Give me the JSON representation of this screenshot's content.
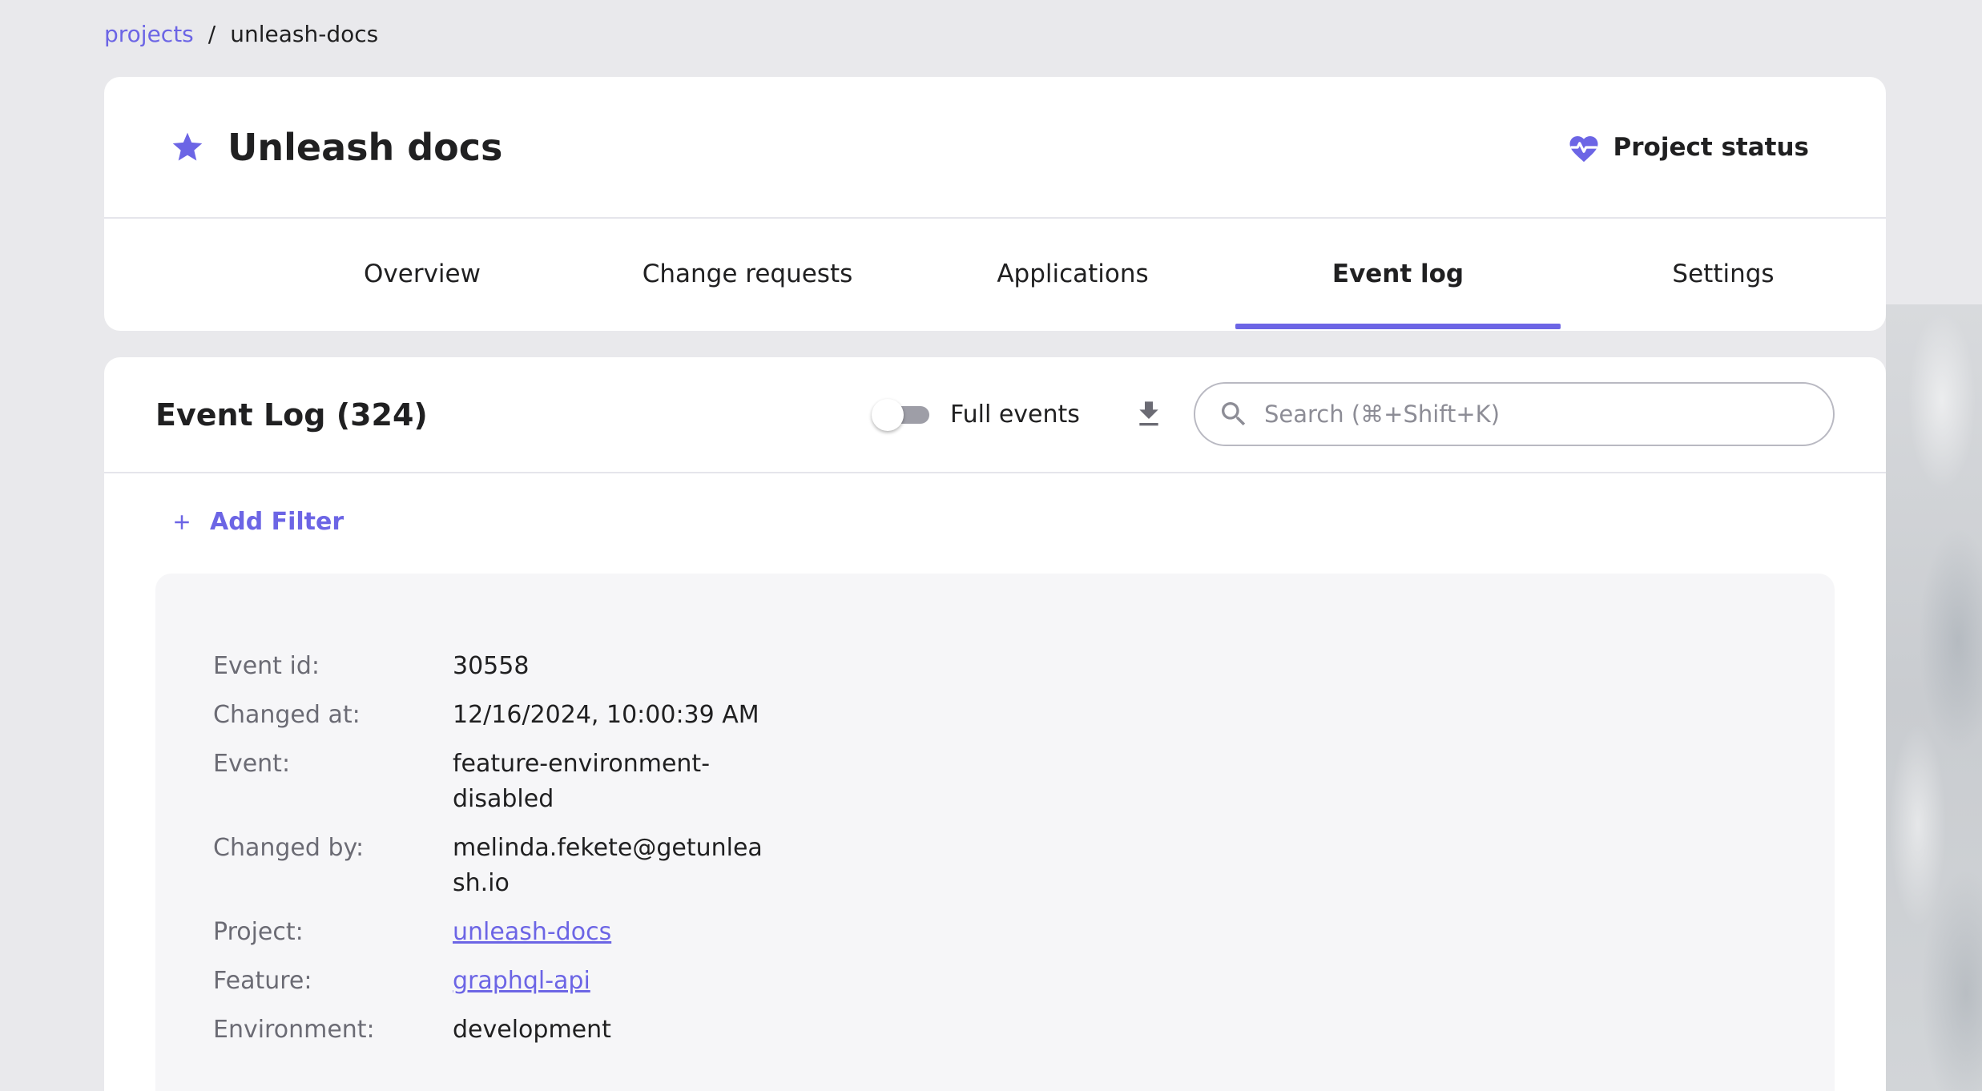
{
  "breadcrumb": {
    "link": "projects",
    "separator": "/",
    "current": "unleash-docs"
  },
  "header": {
    "title": "Unleash docs",
    "favorite_icon": "star-icon",
    "status_label": "Project status",
    "status_icon": "heart-pulse-icon"
  },
  "tabs": [
    {
      "label": "Overview",
      "active": false
    },
    {
      "label": "Change requests",
      "active": false
    },
    {
      "label": "Applications",
      "active": false
    },
    {
      "label": "Event log",
      "active": true
    },
    {
      "label": "Settings",
      "active": false
    }
  ],
  "event_log": {
    "title": "Event Log (324)",
    "full_events_label": "Full events",
    "full_events_on": false,
    "download_icon": "download-icon",
    "search_placeholder": "Search (⌘+Shift+K)",
    "add_filter_label": "Add Filter"
  },
  "event": {
    "rows": [
      {
        "key": "Event id:",
        "value": "30558"
      },
      {
        "key": "Changed at:",
        "value": "12/16/2024, 10:00:39 AM"
      },
      {
        "key": "Event:",
        "value": "feature-environment-disabled"
      },
      {
        "key": "Changed by:",
        "value": "melinda.fekete@getunleash.io"
      },
      {
        "key": "Project:",
        "value": "unleash-docs"
      },
      {
        "key": "Feature:",
        "value": "graphql-api"
      },
      {
        "key": "Environment:",
        "value": "development"
      }
    ]
  },
  "colors": {
    "accent": "#6c65e5",
    "background": "#e9e9ec",
    "card": "#ffffff",
    "panel": "#f6f6f8"
  }
}
